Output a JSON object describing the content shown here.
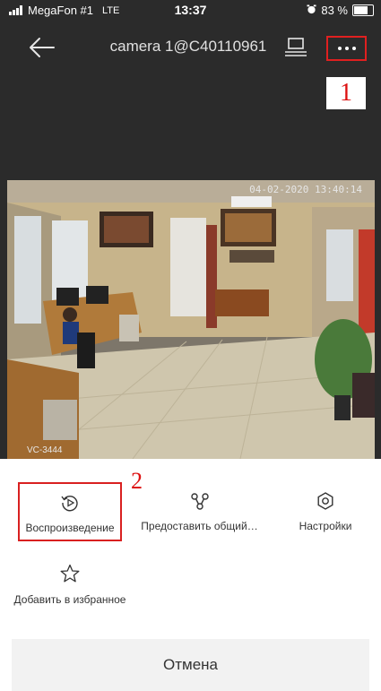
{
  "status_bar": {
    "carrier": "MegaFon #1",
    "network": "LTE",
    "time": "13:37",
    "battery": "83 %",
    "battery_level": 0.83
  },
  "nav": {
    "title": "camera 1@C40110961",
    "icons": [
      "back-arrow-icon",
      "cast-icon",
      "more-icon"
    ]
  },
  "annotations": {
    "marker_1": "1",
    "marker_2": "2"
  },
  "video": {
    "timestamp": "04-02-2020 13:40:14",
    "camera_label": "VC-3444"
  },
  "actions": [
    {
      "label": "Воспроизведение",
      "icon": "playback-icon"
    },
    {
      "label": "Предоставить общий…",
      "icon": "share-icon"
    },
    {
      "label": "Настройки",
      "icon": "settings-icon"
    },
    {
      "label": "Добавить в избранное",
      "icon": "star-icon"
    }
  ],
  "cancel_label": "Отмена",
  "colors": {
    "annotation_red": "#d92020",
    "header_bg": "#2b2b2b"
  }
}
